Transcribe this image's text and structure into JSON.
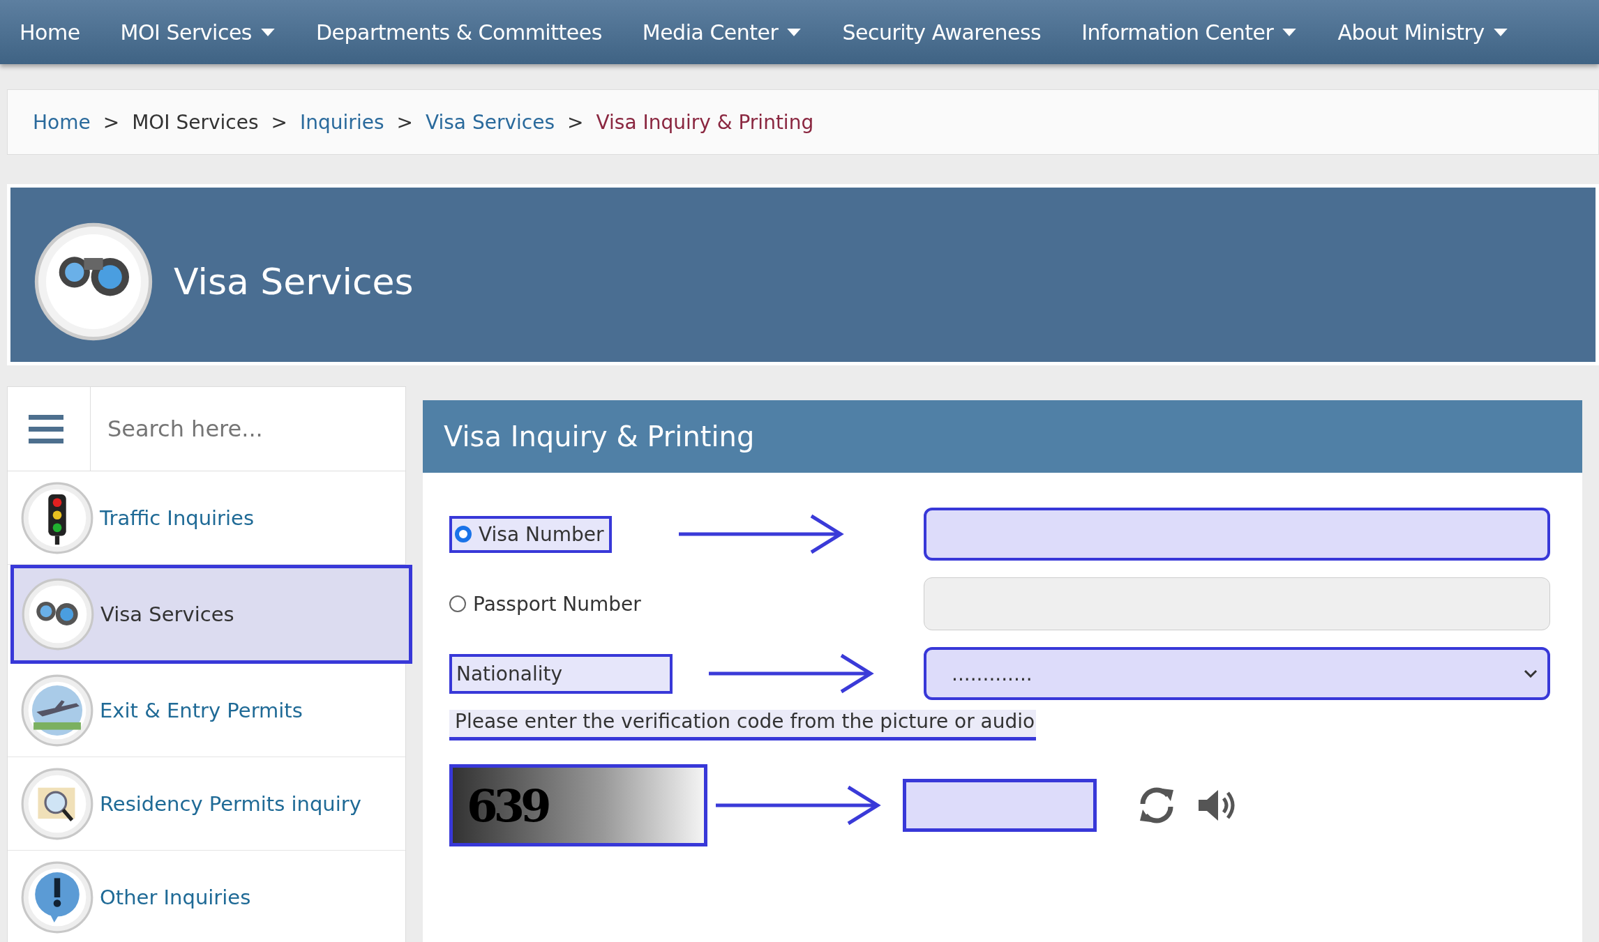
{
  "nav": [
    {
      "label": "Home",
      "has_menu": false
    },
    {
      "label": "MOI Services",
      "has_menu": true
    },
    {
      "label": "Departments & Committees",
      "has_menu": false
    },
    {
      "label": "Media Center",
      "has_menu": true
    },
    {
      "label": "Security Awareness",
      "has_menu": false
    },
    {
      "label": "Information Center",
      "has_menu": true
    },
    {
      "label": "About Ministry",
      "has_menu": true
    }
  ],
  "breadcrumb": [
    {
      "label": "Home",
      "kind": "link"
    },
    {
      "label": "MOI Services",
      "kind": "plain"
    },
    {
      "label": "Inquiries",
      "kind": "link"
    },
    {
      "label": "Visa Services",
      "kind": "link"
    },
    {
      "label": "Visa Inquiry & Printing",
      "kind": "current"
    }
  ],
  "breadcrumb_separator": ">",
  "banner": {
    "title": "Visa Services"
  },
  "sidebar": {
    "search": {
      "placeholder": "Search here..."
    },
    "items": [
      {
        "label": "Traffic Inquiries",
        "kind": "traffic",
        "selected": false
      },
      {
        "label": "Visa Services",
        "kind": "binoculars",
        "selected": true
      },
      {
        "label": "Exit & Entry Permits",
        "kind": "plane",
        "selected": false
      },
      {
        "label": "Residency Permits inquiry",
        "kind": "document",
        "selected": false
      },
      {
        "label": "Other Inquiries",
        "kind": "alert",
        "selected": false
      }
    ]
  },
  "form": {
    "title": "Visa Inquiry & Printing",
    "options": [
      {
        "label": "Visa Number",
        "selected": true
      },
      {
        "label": "Passport Number",
        "selected": false
      }
    ],
    "nationality": {
      "label": "Nationality",
      "value": "............."
    },
    "hint": "Please enter the verification code from the picture or audio",
    "captcha_text": "639"
  }
}
